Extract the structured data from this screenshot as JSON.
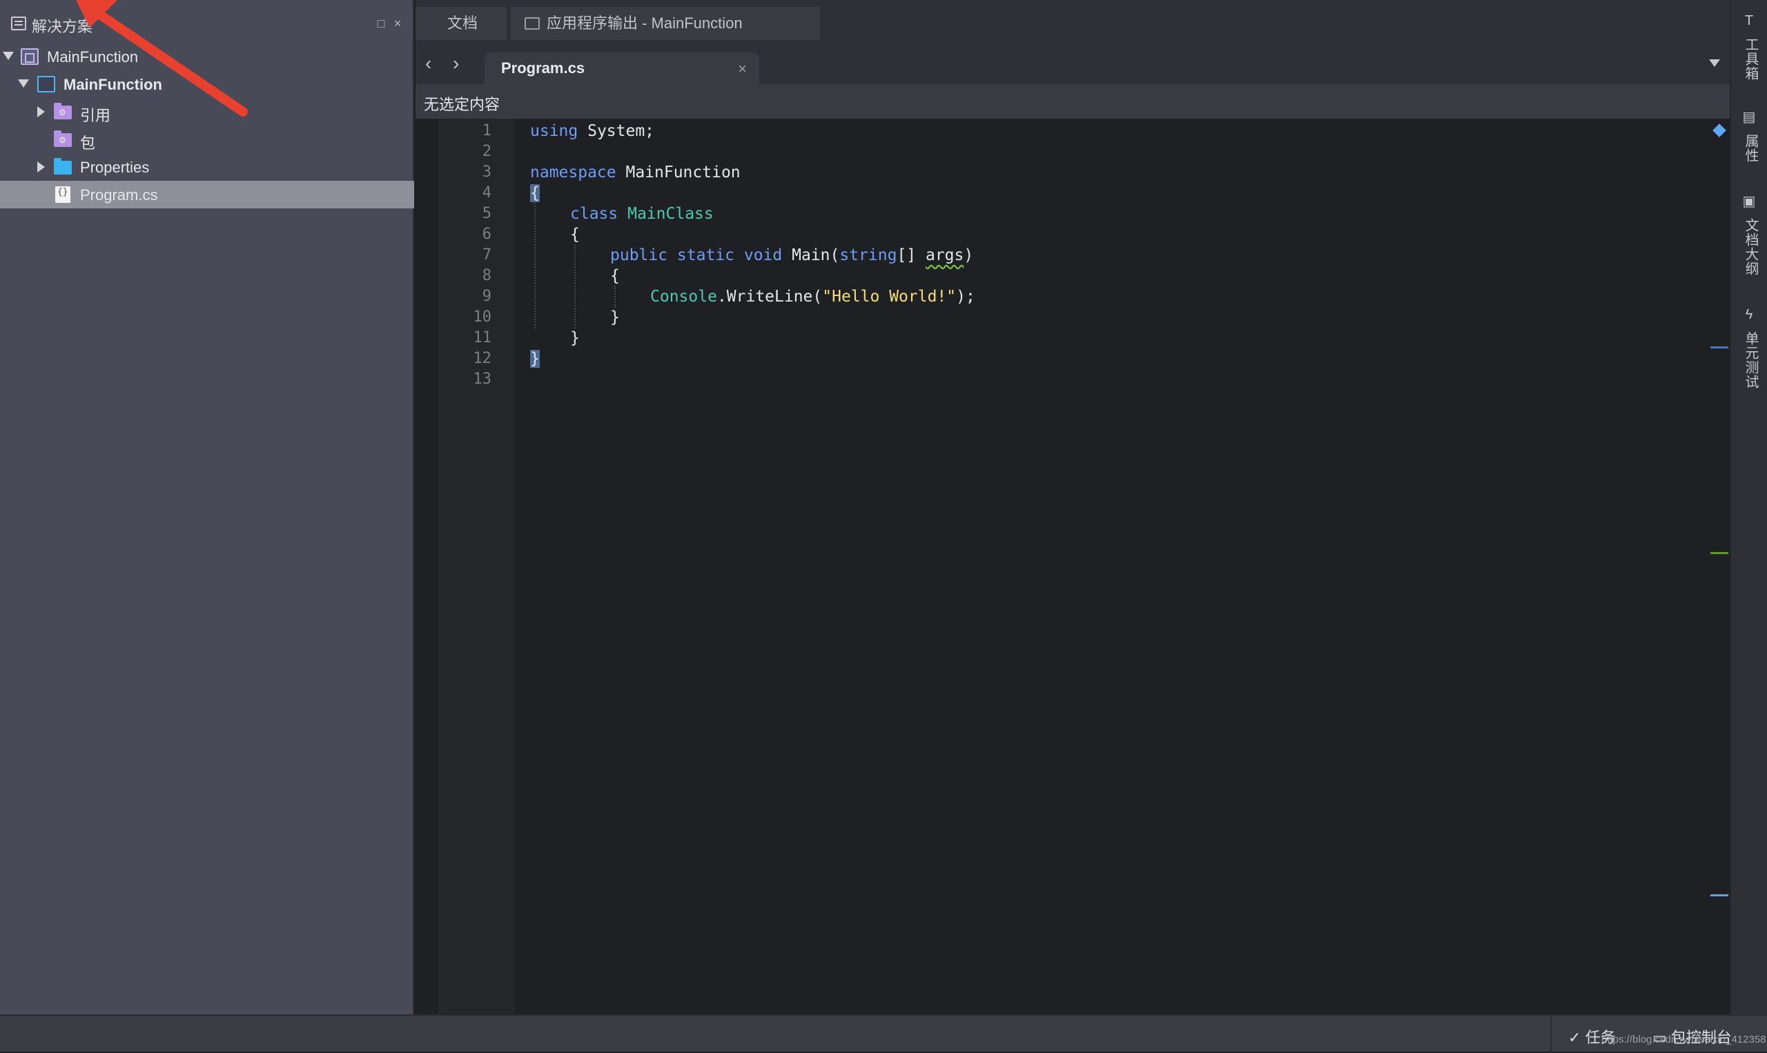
{
  "sidebar": {
    "title": "解决方案",
    "tree": [
      {
        "label": "MainFunction",
        "kind": "solution"
      },
      {
        "label": "MainFunction",
        "kind": "project"
      },
      {
        "label": "引用",
        "kind": "references"
      },
      {
        "label": "包",
        "kind": "packages"
      },
      {
        "label": "Properties",
        "kind": "folder"
      },
      {
        "label": "Program.cs",
        "kind": "file",
        "selected": true
      }
    ]
  },
  "top_tabs": [
    {
      "label": "文档"
    },
    {
      "label": "应用程序输出 - MainFunction"
    }
  ],
  "editor": {
    "tab_label": "Program.cs",
    "breadcrumb": "无选定内容",
    "line_numbers": [
      "1",
      "2",
      "3",
      "4",
      "5",
      "6",
      "7",
      "8",
      "9",
      "10",
      "11",
      "12",
      "13"
    ],
    "code": {
      "l1_kw": "using",
      "l1_rest": " System;",
      "l3_kw": "namespace",
      "l3_rest": " MainFunction",
      "l4_brace": "{",
      "l5_kw": "class",
      "l5_type": "MainClass",
      "l6": "{",
      "l7_kw": "public static void",
      "l7_name": " Main(",
      "l7_kw2": "string",
      "l7_mid": "[] ",
      "l7_arg": "args",
      "l7_end": ")",
      "l8": "{",
      "l9_type": "Console",
      "l9_call": ".WriteLine(",
      "l9_str": "\"Hello World!\"",
      "l9_end": ");",
      "l10": "}",
      "l11": "}",
      "l12_brace": "}"
    }
  },
  "right_dock": [
    "工具箱",
    "属性",
    "文档大纲",
    "单元测试"
  ],
  "status": {
    "tasks": "任务",
    "console": "包控制台",
    "watermark": "https://blog.csdn.net/weixin_412358"
  },
  "colors": {
    "keyword": "#6c9ef8",
    "type": "#4ec9b0",
    "string": "#f4de7a",
    "annotation_arrow": "#e8412f"
  }
}
